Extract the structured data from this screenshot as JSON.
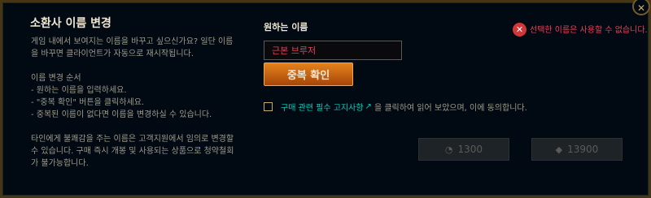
{
  "dialog": {
    "title": "소환사 이름 변경",
    "intro": [
      "게임 내에서 보여지는 이름을 바꾸고 싶으신가요? 일단 이름",
      "을 바꾸면 클라이언트가 자동으로 재시작됩니다."
    ],
    "steps_title": "이름 변경 순서",
    "steps": [
      "- 원하는 이름을 입력하세요.",
      "- \"중복 확인\" 버튼을 클릭하세요.",
      "- 중복된 이름이 없다면 이름을 변경하실 수 있습니다."
    ],
    "warning": [
      "타인에게 불쾌감을 주는 이름은 고객지원에서 임의로 변경할",
      "수 있습니다. 구매 즉시 개봉 및 사용되는 상품으로 청약철회",
      "가 불가능합니다."
    ]
  },
  "form": {
    "field_label": "원하는 이름",
    "input_value": "근본 브루저",
    "check_button": "중복 확인"
  },
  "agreement": {
    "link_text": "구매 관련 필수 고지사항",
    "rest_text": "을 클릭하여 읽어 보았으며, 이에 동의합니다."
  },
  "error": {
    "message": "선택한 이름은 사용할 수 없습니다."
  },
  "prices": {
    "rp": "1300",
    "be": "13900"
  },
  "icons": {
    "close": "close-icon",
    "error": "error-icon",
    "external": "external-link-icon",
    "rp": "rp-currency-icon",
    "be": "blue-essence-icon"
  },
  "colors": {
    "background": "#010a13",
    "gold": "#c8aa6e",
    "title": "#f0e6d2",
    "error": "#e84057",
    "link": "#0ac8b9",
    "button": "#e4821c"
  }
}
